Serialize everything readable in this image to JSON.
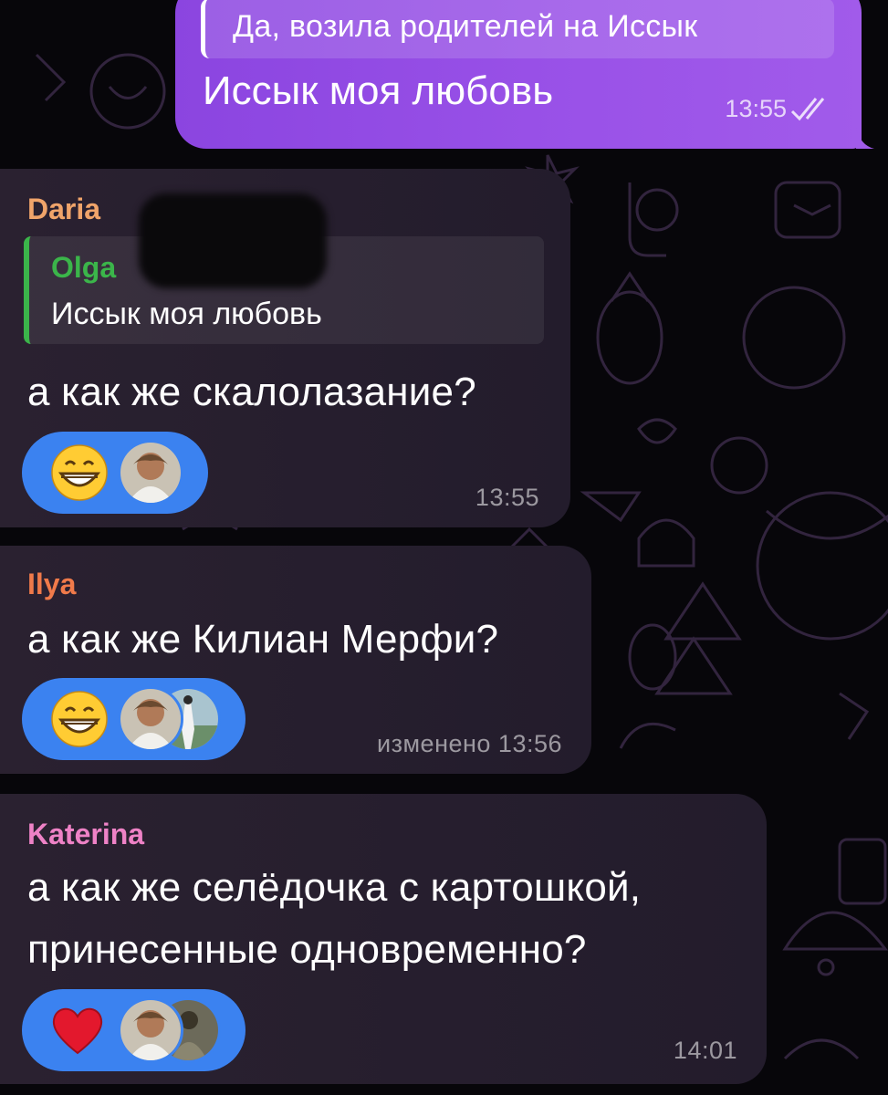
{
  "messages": {
    "outgoing": {
      "reply_text": "Да, возила родителей на Иссык",
      "text": "Иссык моя любовь",
      "time": "13:55",
      "status_icon": "double-check-icon"
    },
    "daria": {
      "sender": "Daria",
      "sender_color": "#f0a46a",
      "quote_name": "Olga",
      "quote_text": "Иссык моя любовь",
      "text": "а как же скалолазание?",
      "reaction": "grinning-face-emoji",
      "time": "13:55"
    },
    "ilya": {
      "sender": "Ilya",
      "sender_color": "#f07a4a",
      "text": "а как же Килиан Мерфи?",
      "reaction": "grinning-face-emoji",
      "time": "изменено 13:56"
    },
    "katerina": {
      "sender": "Katerina",
      "sender_color": "#ee82c6",
      "text_line1": "а как же селёдочка с картошкой,",
      "text_line2": "принесенные одновременно?",
      "reaction": "red-heart-emoji",
      "time": "14:01"
    }
  },
  "colors": {
    "outgoing_bubble": "#9a52e8",
    "incoming_bubble": "#261e2e",
    "reaction_pill": "#3b82f0",
    "quote_accent": "#3bb54a"
  }
}
